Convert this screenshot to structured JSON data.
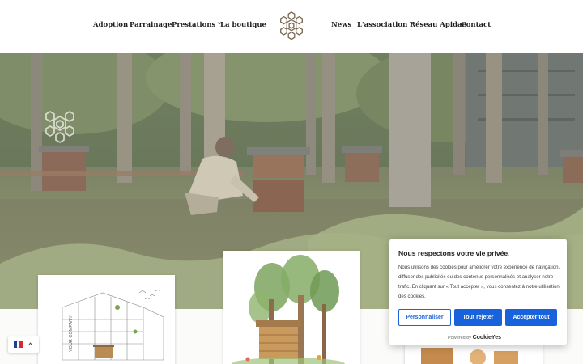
{
  "nav": {
    "left": [
      {
        "label": "Adoption"
      },
      {
        "label": "Parrainage"
      },
      {
        "label": "Prestations",
        "dropdown": true
      },
      {
        "label": "La boutique"
      }
    ],
    "right": [
      {
        "label": "News"
      },
      {
        "label": "L'association",
        "dropdown": true
      },
      {
        "label": "Réseau Apidae"
      },
      {
        "label": "Contact"
      }
    ]
  },
  "logo": {
    "icon": "hexagon-bee-logo-icon"
  },
  "hero": {
    "icon": "watermark-logo-icon"
  },
  "cards": [
    {
      "label_vertical": "YOUR COMPANY"
    },
    {},
    {}
  ],
  "cookie_banner": {
    "title": "Nous respectons votre vie privée.",
    "text": "Nous utilisons des cookies pour améliorer votre expérience de navigation, diffuser des publicités ou des contenus personnalisés et analyser notre trafic. En cliquant sur « Tout accepter », vous consentez à notre utilisation des cookies.",
    "buttons": {
      "customize": "Personnaliser",
      "reject": "Tout rejeter",
      "accept": "Accepter tout"
    },
    "powered_by": "Powered by",
    "brand": "CookieYes",
    "accent": "#1863dc"
  },
  "language": {
    "flag": "french-flag-icon",
    "code": "FR"
  }
}
